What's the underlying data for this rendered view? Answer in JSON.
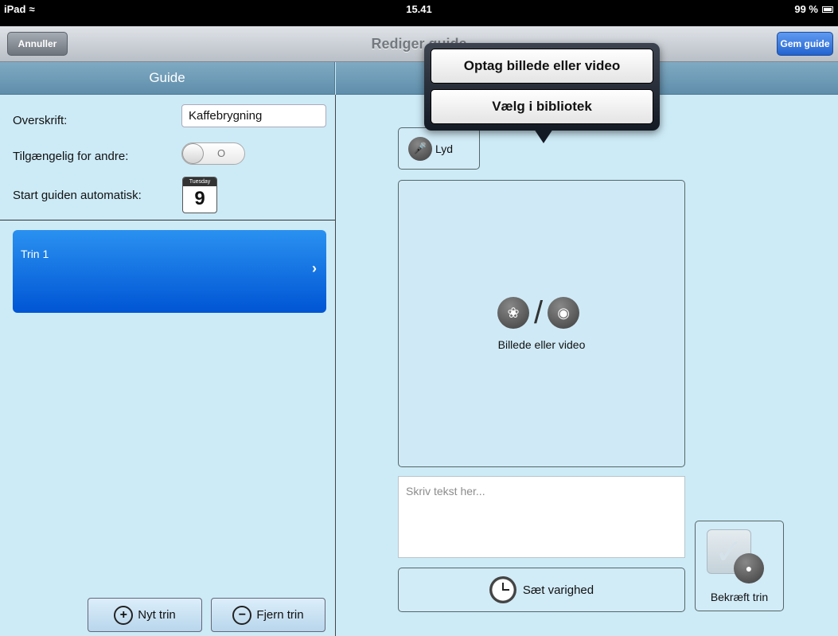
{
  "statusbar": {
    "device": "iPad",
    "time": "15.41",
    "battery": "99 %"
  },
  "navbar": {
    "cancel_label": "Annuller",
    "title": "Rediger guide",
    "save_label": "Gem guide"
  },
  "left_panel": {
    "header": "Guide",
    "title_label": "Overskrift:",
    "title_value": "Kaffebrygning",
    "available_label": "Tilgængelig for andre:",
    "available_toggle": "O",
    "autostart_label": "Start guiden automatisk:",
    "calendar_day": "Tuesday",
    "calendar_date": "9",
    "steps": [
      {
        "label": "Trin 1"
      }
    ],
    "new_step_label": "Nyt trin",
    "remove_step_label": "Fjern trin"
  },
  "right_panel": {
    "audio_label": "Lyd",
    "media_label": "Billede eller video",
    "text_placeholder": "Skriv tekst her...",
    "duration_label": "Sæt varighed",
    "confirm_label": "Bekræft trin"
  },
  "popover": {
    "capture_label": "Optag billede eller video",
    "library_label": "Vælg i bibliotek"
  },
  "colors": {
    "background": "#cdebf7",
    "section_header": "#6e9ab7",
    "step_selected": "#0a6ee0",
    "save_button": "#2f6fdc"
  }
}
